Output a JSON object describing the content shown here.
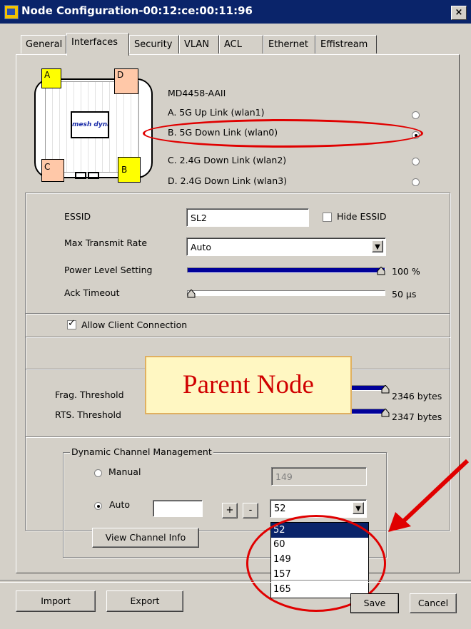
{
  "window": {
    "title": "Node Configuration-00:12:ce:00:11:96",
    "close_label": "×"
  },
  "tabs": [
    "General",
    "Interfaces",
    "Security",
    "VLAN",
    "ACL",
    "Ethernet",
    "Effistream"
  ],
  "device": {
    "model": "MD4458-AAII",
    "corners": {
      "a": "A",
      "b": "B",
      "c": "C",
      "d": "D"
    },
    "logo_text": "mesh dynamics",
    "links": [
      {
        "label": "A. 5G  Up Link (wlan1)",
        "selected": false
      },
      {
        "label": "B. 5G  Down Link (wlan0)",
        "selected": true
      },
      {
        "label": "C. 2.4G  Down Link (wlan2)",
        "selected": false
      },
      {
        "label": "D. 2.4G  Down Link (wlan3)",
        "selected": false
      }
    ]
  },
  "settings": {
    "essid_label": "ESSID",
    "essid_value": "SL2",
    "hide_essid_label": "Hide ESSID",
    "hide_essid_checked": false,
    "max_rate_label": "Max Transmit Rate",
    "max_rate_value": "Auto",
    "power_label": "Power Level Setting",
    "power_value": "100 %",
    "power_fraction": 1.0,
    "ack_label": "Ack Timeout",
    "ack_value": "50 µs",
    "ack_fraction": 0.0,
    "allow_client_label": "Allow Client Connection",
    "allow_client_checked": true
  },
  "thresholds": {
    "frag_label": "Frag. Threshold",
    "frag_value": "2346 bytes",
    "rts_label": "RTS. Threshold",
    "rts_value": "2347 bytes"
  },
  "overlay": {
    "parent_node_text": "Parent Node"
  },
  "dcm": {
    "title": "Dynamic Channel Management",
    "manual_label": "Manual",
    "manual_channel": "149",
    "auto_label": "Auto",
    "auto_selected": true,
    "auto_input_value": "",
    "plus_label": "+",
    "minus_label": "-",
    "channel_selected": "52",
    "channel_options": [
      "52",
      "60",
      "149",
      "157",
      "165"
    ],
    "view_info_label": "View Channel Info"
  },
  "footer": {
    "import_label": "Import",
    "export_label": "Export",
    "save_label": "Save",
    "cancel_label": "Cancel"
  },
  "colors": {
    "titlebar": "#0a246a",
    "annotation_red": "#e00000",
    "slider_fill": "#000099",
    "corner_yellow": "#ffff00",
    "corner_salmon": "#ffc8a8",
    "parent_note_bg": "#fff7c2"
  }
}
